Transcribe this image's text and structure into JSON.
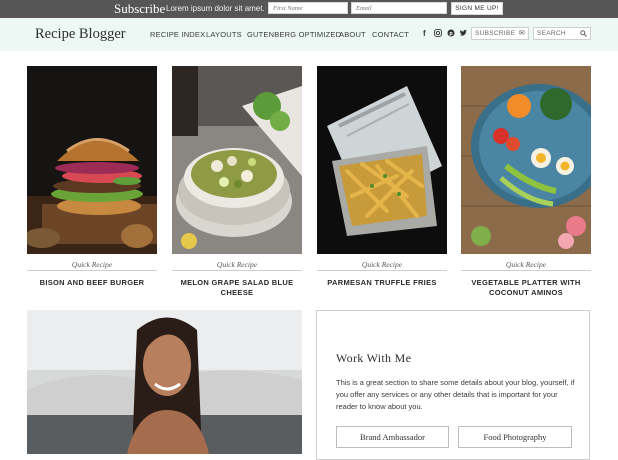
{
  "subscribe": {
    "title": "Subscribe",
    "description": "Lorem ipsum dolor sit amet.",
    "first_name_placeholder": "First Name",
    "email_placeholder": "Email",
    "button": "SIGN ME UP!"
  },
  "header": {
    "logo": "Recipe Blogger",
    "nav": [
      "RECIPE INDEX",
      "LAYOUTS",
      "GUTENBERG OPTIMIZED",
      "ABOUT",
      "CONTACT"
    ],
    "social_icons": [
      "facebook-icon",
      "instagram-icon",
      "pinterest-icon",
      "twitter-icon"
    ],
    "subscribe_box": "SUBSCRIBE",
    "search_box": "SEARCH"
  },
  "cards": [
    {
      "category": "Quick Recipe",
      "title": "BISON AND BEEF BURGER"
    },
    {
      "category": "Quick Recipe",
      "title": "MELON GRAPE SALAD BLUE CHEESE"
    },
    {
      "category": "Quick Recipe",
      "title": "PARMESAN TRUFFLE FRIES"
    },
    {
      "category": "Quick Recipe",
      "title": "VEGETABLE PLATTER WITH COCONUT AMINOS"
    }
  ],
  "work": {
    "title": "Work With Me",
    "text": "This is a great section to share some details about your blog, yourself, if you offer any services or any other details that is important for your reader to know about you.",
    "buttons": [
      "Brand Ambassador",
      "Food Photography"
    ]
  },
  "colors": {
    "subscribe_bar": "#565656",
    "header_bg": "#edf8f4"
  }
}
